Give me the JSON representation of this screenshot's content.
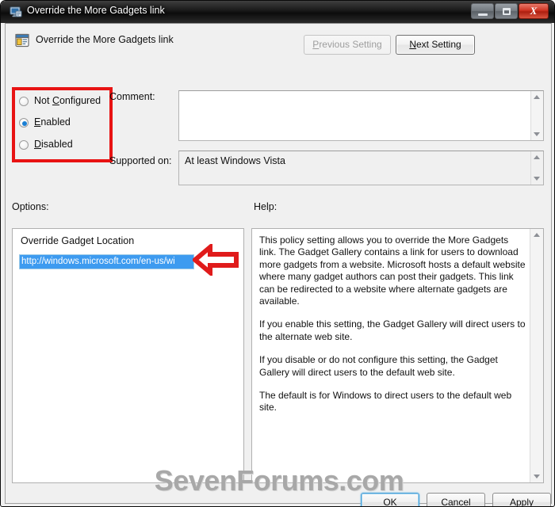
{
  "window": {
    "title": "Override the More Gadgets link",
    "title_icon": "policy-window-icon",
    "controls": {
      "minimize": "minimize-icon",
      "maximize": "maximize-icon",
      "close": "X"
    }
  },
  "header": {
    "icon": "group-policy-setting-icon",
    "title": "Override the More Gadgets link",
    "previous_setting": "Previous Setting",
    "next_setting": "Next Setting"
  },
  "state": {
    "options": [
      "Not Configured",
      "Enabled",
      "Disabled"
    ],
    "selected": "Enabled"
  },
  "comment": {
    "label": "Comment:",
    "value": "",
    "placeholder": ""
  },
  "supported": {
    "label": "Supported on:",
    "value": "At least Windows Vista"
  },
  "options_panel": {
    "label": "Options:",
    "group_title": "Override Gadget Location",
    "url_value": "http://windows.microsoft.com/en-us/wi",
    "url_selected": true
  },
  "help_panel": {
    "label": "Help:",
    "paragraphs": [
      "This policy setting allows you to override the More Gadgets link. The Gadget Gallery contains a link for users to download  more gadgets from a website. Microsoft hosts a default website where many gadget authors can post their gadgets. This link can be redirected to a website where alternate gadgets  are available.",
      "If you enable this setting, the Gadget Gallery will direct users to the alternate web site.",
      "If you disable or do not configure this setting, the Gadget Gallery will direct users to the default web site.",
      "The default is for Windows to direct users to the default web site."
    ]
  },
  "footer": {
    "ok": "OK",
    "cancel": "Cancel",
    "apply": "Apply"
  },
  "watermark": "SevenForums.com",
  "annotations": {
    "highlight_color": "#e81313",
    "arrow_color": "#e01b1b",
    "arrow_direction": "left"
  }
}
